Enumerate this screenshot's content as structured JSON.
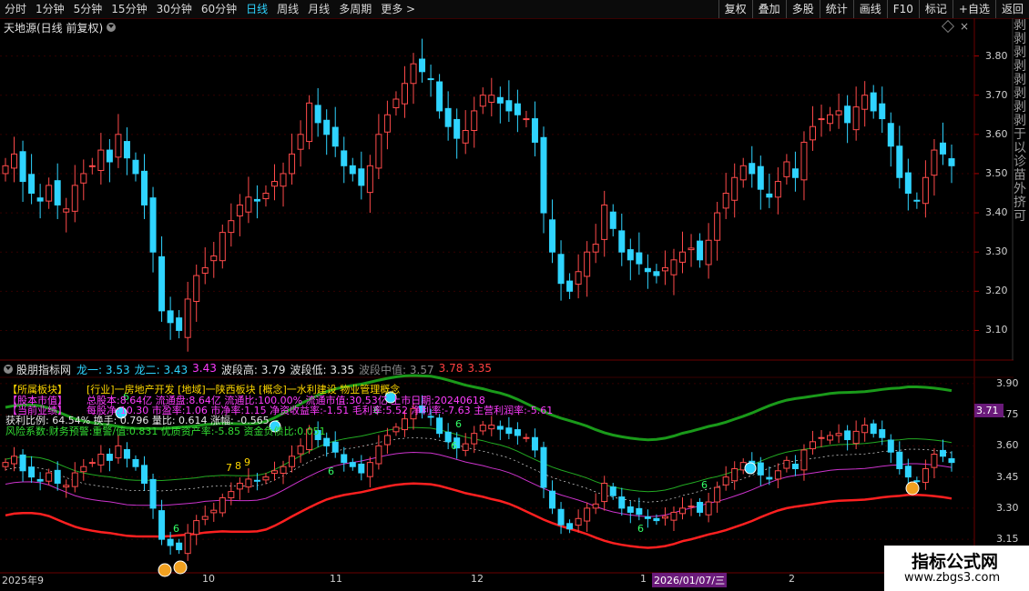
{
  "toolbar": {
    "timeframes": [
      "分时",
      "1分钟",
      "5分钟",
      "15分钟",
      "30分钟",
      "60分钟",
      "日线",
      "周线",
      "月线",
      "多周期",
      "更多 >"
    ],
    "active": "日线",
    "tools": [
      "复权",
      "叠加",
      "多股",
      "统计",
      "画线",
      "F10",
      "标记",
      "+自选",
      "返回"
    ]
  },
  "main": {
    "title": "天地源(日线 前复权)",
    "y_labels": [
      "3.80",
      "3.70",
      "3.60",
      "3.50",
      "3.40",
      "3.30",
      "3.20",
      "3.10"
    ],
    "right_strip": "剥剥剥剥剥剥剥剥于以诊苗外挤可"
  },
  "indicator": {
    "name": "股朋指标网",
    "values": [
      {
        "label": "龙一:",
        "value": "3.53",
        "color": "#2fd4ff"
      },
      {
        "label": "龙二:",
        "value": "3.43",
        "color": "#2fd4ff"
      },
      {
        "label": "",
        "value": "3.43",
        "color": "#ff3cff"
      },
      {
        "label": "波段高:",
        "value": "3.79",
        "color": "#e0e0e0"
      },
      {
        "label": "波段低:",
        "value": "3.35",
        "color": "#e0e0e0"
      },
      {
        "label": "波段中值:",
        "value": "3.57",
        "color": "#888888"
      },
      {
        "label": "",
        "value": "3.78",
        "color": "#ff4040"
      },
      {
        "label": "",
        "value": "3.35",
        "color": "#ff4040"
      }
    ],
    "y_labels": [
      "3.90",
      "3.75",
      "3.60",
      "3.45",
      "3.30",
      "3.15"
    ],
    "current_price": "3.71",
    "info": {
      "sector_label": "【所属板块】",
      "sector_text": "[行业]一房地产开发 [地域]一陕西板块 [概念]一水利建设 物业管理概念",
      "basic_label": "【股本市值】",
      "basic_text": "总股本:8.64亿  流通盘:8.64亿  流通比:100.00%  流通市值:30.53亿  上市日期:20240618",
      "fin_label": "【当前业绩】",
      "fin_text": "每股净:10.30  市盈率:1.06  市净率:1.15  净资收益率:-1.51  毛利率:5.52  净利率:-7.63  主营利润率:-5.61",
      "hold_text": "获利比例: 64.54%  换手: 0.796  量比: 0.614  涨幅: -0.565",
      "risk_text": "风险系数:财务预警:重警/值:0.831 优质资产率:-5.85 资金负债比:0.051"
    },
    "markers": [
      "6",
      "6",
      "6",
      "6",
      "6",
      "6",
      "6",
      "6",
      "6",
      "7",
      "8",
      "9"
    ]
  },
  "x_labels": [
    "2025年9",
    "10",
    "11",
    "12",
    "1",
    "2026/01/07/三",
    "2"
  ],
  "watermark": {
    "line1": "指标公式网",
    "line2": "www.zbgs3.com"
  },
  "chart_data": {
    "type": "candlestick",
    "title": "天地源(日线 前复权)",
    "ylim_main": [
      3.05,
      3.85
    ],
    "ylim_indicator": [
      3.12,
      3.93
    ],
    "closes": [
      3.52,
      3.55,
      3.48,
      3.45,
      3.43,
      3.47,
      3.42,
      3.41,
      3.47,
      3.5,
      3.52,
      3.56,
      3.53,
      3.6,
      3.54,
      3.5,
      3.42,
      3.3,
      3.15,
      3.12,
      3.1,
      3.18,
      3.24,
      3.26,
      3.29,
      3.35,
      3.38,
      3.42,
      3.44,
      3.43,
      3.45,
      3.48,
      3.5,
      3.55,
      3.6,
      3.68,
      3.63,
      3.6,
      3.57,
      3.52,
      3.5,
      3.47,
      3.52,
      3.6,
      3.65,
      3.69,
      3.73,
      3.78,
      3.76,
      3.74,
      3.66,
      3.62,
      3.59,
      3.61,
      3.66,
      3.7,
      3.7,
      3.68,
      3.66,
      3.65,
      3.64,
      3.58,
      3.4,
      3.3,
      3.22,
      3.2,
      3.25,
      3.3,
      3.32,
      3.42,
      3.36,
      3.3,
      3.28,
      3.27,
      3.25,
      3.24,
      3.26,
      3.28,
      3.3,
      3.31,
      3.28,
      3.33,
      3.4,
      3.45,
      3.49,
      3.52,
      3.5,
      3.46,
      3.44,
      3.48,
      3.53,
      3.49,
      3.58,
      3.62,
      3.64,
      3.65,
      3.66,
      3.63,
      3.67,
      3.7,
      3.66,
      3.64,
      3.57,
      3.49,
      3.45,
      3.43,
      3.49,
      3.56,
      3.55,
      3.52
    ],
    "upper_band_color": "#ff2020",
    "lower_band_color": "#1a9a1a"
  }
}
